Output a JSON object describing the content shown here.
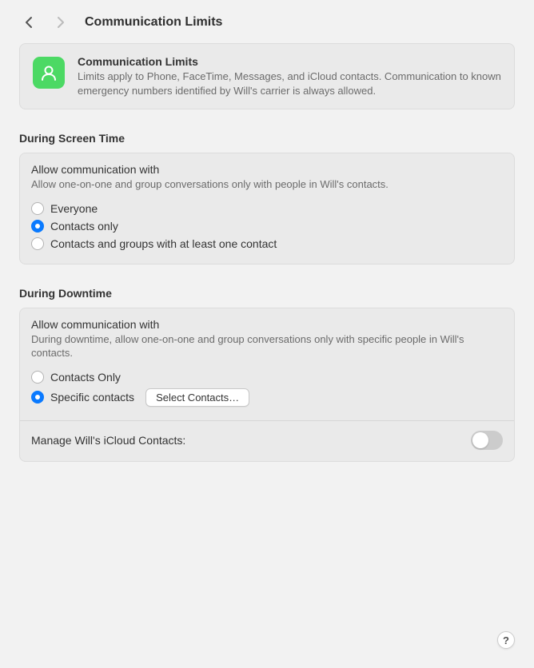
{
  "header": {
    "title": "Communication Limits"
  },
  "info_card": {
    "title": "Communication Limits",
    "description": "Limits apply to Phone, FaceTime, Messages, and iCloud contacts. Communication to known emergency numbers identified by Will's carrier is always allowed."
  },
  "section_screentime": {
    "title": "During Screen Time",
    "panel_subtitle": "Allow communication with",
    "panel_desc": "Allow one-on-one and group conversations only with people in Will's contacts.",
    "options": [
      {
        "label": "Everyone",
        "selected": false
      },
      {
        "label": "Contacts only",
        "selected": true
      },
      {
        "label": "Contacts and groups with at least one contact",
        "selected": false
      }
    ]
  },
  "section_downtime": {
    "title": "During Downtime",
    "panel_subtitle": "Allow communication with",
    "panel_desc": "During downtime, allow one-on-one and group conversations only with specific people in Will's contacts.",
    "options": [
      {
        "label": "Contacts Only",
        "selected": false
      },
      {
        "label": "Specific contacts",
        "selected": true
      }
    ],
    "select_button": "Select Contacts…",
    "manage_label": "Manage Will's iCloud Contacts:",
    "manage_toggle": false
  },
  "help_label": "?"
}
